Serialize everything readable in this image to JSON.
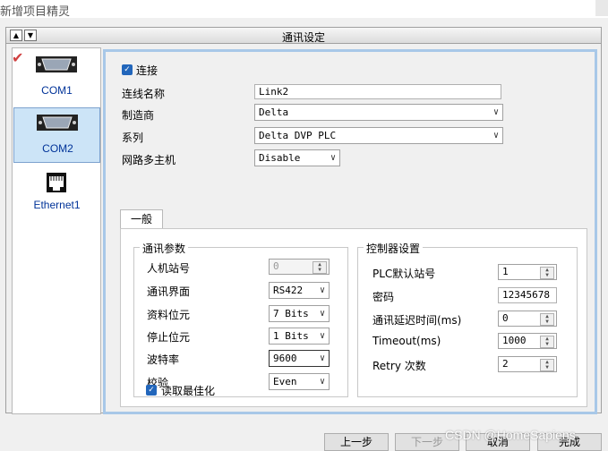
{
  "window_title": "新增项目精灵",
  "header_title": "通讯设定",
  "devices": [
    {
      "label": "COM1",
      "icon": "serial-port-icon"
    },
    {
      "label": "COM2",
      "icon": "serial-port-icon"
    },
    {
      "label": "Ethernet1",
      "icon": "ethernet-port-icon"
    }
  ],
  "connect": {
    "label": "连接",
    "checked": true
  },
  "fields": {
    "conn_name_label": "连线名称",
    "conn_name": "Link2",
    "manufacturer_label": "制造商",
    "manufacturer": "Delta",
    "series_label": "系列",
    "series": "Delta DVP PLC",
    "multi_host_label": "网路多主机",
    "multi_host": "Disable"
  },
  "tab_label": "一般",
  "comm": {
    "title": "通讯参数",
    "hmi_station_label": "人机站号",
    "hmi_station": "0",
    "interface_label": "通讯界面",
    "interface": "RS422",
    "data_bits_label": "资料位元",
    "data_bits": "7 Bits",
    "stop_bits_label": "停止位元",
    "stop_bits": "1 Bits",
    "baud_label": "波特率",
    "baud": "9600",
    "parity_label": "校验",
    "parity": "Even"
  },
  "ctrl": {
    "title": "控制器设置",
    "plc_station_label": "PLC默认站号",
    "plc_station": "1",
    "password_label": "密码",
    "password": "12345678",
    "delay_label": "通讯延迟时间(ms)",
    "delay": "0",
    "timeout_label": "Timeout(ms)",
    "timeout": "1000",
    "retry_label": "Retry 次数",
    "retry": "2"
  },
  "optimize": {
    "label": "读取最佳化",
    "checked": true
  },
  "buttons": {
    "prev": "上一步",
    "next": "下一步",
    "cancel": "取消",
    "finish": "完成"
  },
  "watermark": "CSDN @HomeSapiens",
  "colors": {
    "accent": "#2266bb",
    "selection": "#cce4f7",
    "check": "#d04040"
  }
}
